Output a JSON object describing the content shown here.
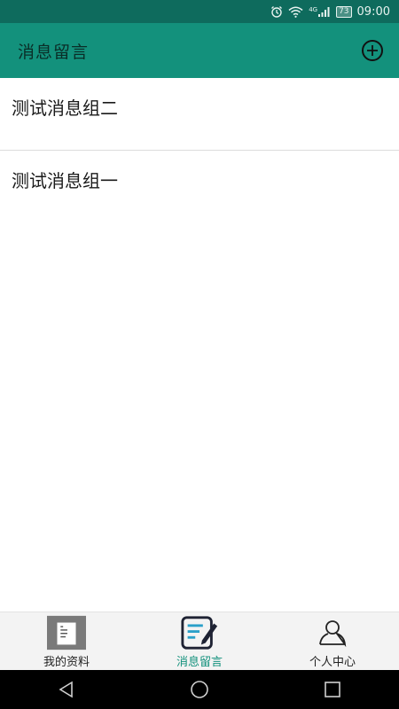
{
  "status_bar": {
    "time": "09:00",
    "battery": "73",
    "network": "4G",
    "icons": [
      "alarm-icon",
      "wifi-icon",
      "signal-icon",
      "battery-icon"
    ]
  },
  "app_bar": {
    "title": "消息留言",
    "add_icon": "plus-circle-icon"
  },
  "list": {
    "items": [
      {
        "label": "测试消息组二"
      },
      {
        "label": "测试消息组一"
      }
    ]
  },
  "tab_bar": {
    "tabs": [
      {
        "label": "我的资料",
        "icon": "profile-doc-icon",
        "active": false
      },
      {
        "label": "消息留言",
        "icon": "edit-note-icon",
        "active": true
      },
      {
        "label": "个人中心",
        "icon": "person-icon",
        "active": false
      }
    ]
  },
  "nav_bar": {
    "buttons": [
      "back-icon",
      "home-icon",
      "recents-icon"
    ]
  },
  "colors": {
    "status_bar": "#0e6b5d",
    "app_bar": "#13917c",
    "active_tab": "#13917c"
  }
}
